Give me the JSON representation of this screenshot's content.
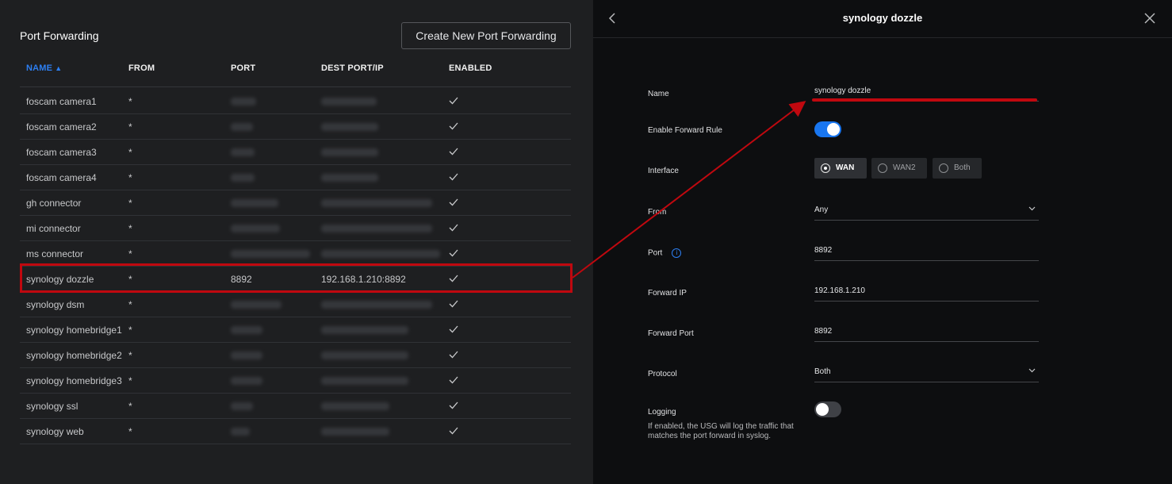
{
  "left": {
    "title": "Port Forwarding",
    "create_button": "Create New Port Forwarding",
    "columns": {
      "name": "NAME",
      "from": "FROM",
      "port": "PORT",
      "dest": "DEST PORT/IP",
      "enabled": "ENABLED"
    },
    "sort_caret": "^",
    "rows": [
      {
        "name": "foscam camera1",
        "from": "*",
        "port": "",
        "dest": "",
        "enabled": true
      },
      {
        "name": "foscam camera2",
        "from": "*",
        "port": "",
        "dest": "",
        "enabled": true
      },
      {
        "name": "foscam camera3",
        "from": "*",
        "port": "",
        "dest": "",
        "enabled": true
      },
      {
        "name": "foscam camera4",
        "from": "*",
        "port": "",
        "dest": "",
        "enabled": true
      },
      {
        "name": "gh connector",
        "from": "*",
        "port": "",
        "dest": "",
        "enabled": true
      },
      {
        "name": "mi connector",
        "from": "*",
        "port": "",
        "dest": "",
        "enabled": true
      },
      {
        "name": "ms connector",
        "from": "*",
        "port": "",
        "dest": "",
        "enabled": true
      },
      {
        "name": "synology dozzle",
        "from": "*",
        "port": "8892",
        "dest": "192.168.1.210:8892",
        "enabled": true
      },
      {
        "name": "synology dsm",
        "from": "*",
        "port": "",
        "dest": "",
        "enabled": true
      },
      {
        "name": "synology homebridge1",
        "from": "*",
        "port": "",
        "dest": "",
        "enabled": true
      },
      {
        "name": "synology homebridge2",
        "from": "*",
        "port": "",
        "dest": "",
        "enabled": true
      },
      {
        "name": "synology homebridge3",
        "from": "*",
        "port": "",
        "dest": "",
        "enabled": true
      },
      {
        "name": "synology ssl",
        "from": "*",
        "port": "",
        "dest": "",
        "enabled": true
      },
      {
        "name": "synology web",
        "from": "*",
        "port": "",
        "dest": "",
        "enabled": true
      }
    ]
  },
  "right": {
    "title": "synology dozzle",
    "fields": {
      "name_label": "Name",
      "name_value": "synology dozzle",
      "enable_label": "Enable Forward Rule",
      "enable_on": true,
      "interface_label": "Interface",
      "interface_options": [
        "WAN",
        "WAN2",
        "Both"
      ],
      "interface_selected": "WAN",
      "from_label": "From",
      "from_value": "Any",
      "port_label": "Port",
      "port_info_glyph": "i",
      "port_value": "8892",
      "forward_ip_label": "Forward IP",
      "forward_ip_value": "192.168.1.210",
      "forward_port_label": "Forward Port",
      "forward_port_value": "8892",
      "protocol_label": "Protocol",
      "protocol_value": "Both",
      "logging_label": "Logging",
      "logging_on": false,
      "logging_help": "If enabled, the USG will log the traffic that matches the port forward in syslog."
    }
  },
  "colors": {
    "accent": "#1976f0",
    "highlight": "#c0080f",
    "left_bg": "#1e1f21",
    "right_bg": "#0d0e10"
  }
}
